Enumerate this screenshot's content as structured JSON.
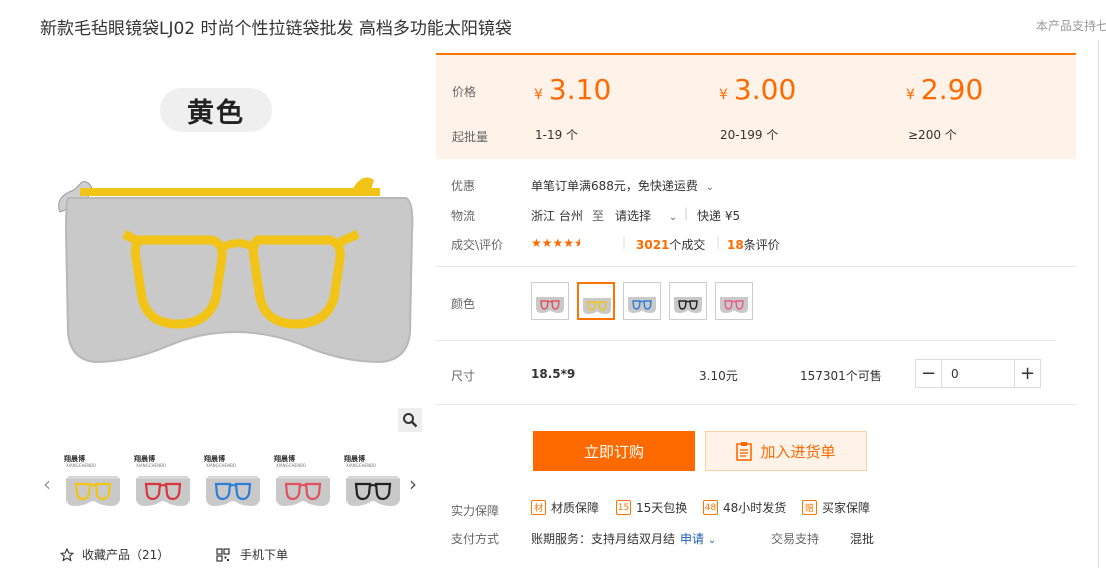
{
  "product": {
    "title": "新款毛毡眼镜袋LJ02 时尚个性拉链袋批发 高档多功能太阳镜袋",
    "support_hint": "本产品支持七",
    "image_color_label": "黄色"
  },
  "gallery": {
    "thumbnails": [
      {
        "brand": "翔晨博",
        "brand_sub": "XIANGCHENBO",
        "frame_color": "#f2c418"
      },
      {
        "brand": "翔晨博",
        "brand_sub": "XIANGCHENBO",
        "frame_color": "#d9363e"
      },
      {
        "brand": "翔晨博",
        "brand_sub": "XIANGCHENBO",
        "frame_color": "#2f7fd6"
      },
      {
        "brand": "翔晨博",
        "brand_sub": "XIANGCHENBO",
        "frame_color": "#e0525e"
      },
      {
        "brand": "翔晨博",
        "brand_sub": "XIANGCHENBO",
        "frame_color": "#222222"
      }
    ],
    "favorite_label": "收藏产品（21）",
    "mobile_order_label": "手机下单"
  },
  "pricing": {
    "price_label": "价格",
    "moq_label": "起批量",
    "currency": "¥",
    "tiers": [
      {
        "price": "3.10",
        "range": "1-19 个"
      },
      {
        "price": "3.00",
        "range": "20-199 个"
      },
      {
        "price": "2.90",
        "range": "≥200 个"
      }
    ]
  },
  "info": {
    "discount_label": "优惠",
    "discount_text": "单笔订单满688元，免快递运费",
    "logistics_label": "物流",
    "origin": "浙江 台州",
    "to": "至",
    "destination": "请选择",
    "express": "快递 ¥5",
    "deals_label": "成交\\评价",
    "deals_count": "3021",
    "deals_suffix": "个成交",
    "reviews_count": "18",
    "reviews_suffix": "条评价",
    "rating": 4.5
  },
  "colors": {
    "label": "颜色",
    "swatches": [
      {
        "frame": "#e0525e",
        "active": false
      },
      {
        "frame": "#f2c418",
        "active": true
      },
      {
        "frame": "#2f7fd6",
        "active": false
      },
      {
        "frame": "#222222",
        "active": false
      },
      {
        "frame": "#e45b8a",
        "active": false
      }
    ]
  },
  "size_row": {
    "label": "尺寸",
    "size": "18.5*9",
    "price": "3.10元",
    "stock": "157301个可售",
    "quantity": "0"
  },
  "actions": {
    "buy_now": "立即订购",
    "add_to_list": "加入进货单"
  },
  "guarantees": {
    "label": "实力保障",
    "items": [
      {
        "icon": "材",
        "text": "材质保障"
      },
      {
        "icon": "15",
        "text": "15天包换"
      },
      {
        "icon": "48",
        "text": "48小时发货"
      },
      {
        "icon": "赔",
        "text": "买家保障"
      }
    ]
  },
  "payment": {
    "label": "支付方式",
    "text": "账期服务：支持月结双月结",
    "link": "申请",
    "trade_label": "交易支持",
    "trade_value": "混批"
  },
  "theme": {
    "accent": "#ff6a00",
    "price_bg": "#fff3e9"
  }
}
